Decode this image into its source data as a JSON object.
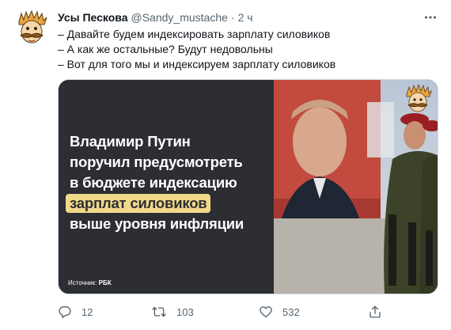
{
  "tweet": {
    "display_name": "Усы Пескова",
    "handle": "@Sandy_mustache",
    "separator": "·",
    "time": "2 ч",
    "lines": [
      "– Давайте будем индексировать зарплату силовиков",
      "– А как же остальные? Будут недовольны",
      "– Вот для того мы и индексируем зарплату силовиков"
    ]
  },
  "media": {
    "headline_lines": [
      "Владимир Путин",
      "поручил предусмотреть",
      "в бюджете индексацию"
    ],
    "highlight": "зарплат силовиков",
    "headline_last": "выше уровня инфляции",
    "source_label": "Источник:",
    "source_name": "РБК"
  },
  "actions": {
    "reply_count": "12",
    "retweet_count": "103",
    "like_count": "532"
  },
  "icons": {
    "more": "more-dots-icon",
    "reply": "reply-icon",
    "retweet": "retweet-icon",
    "like": "heart-icon",
    "share": "share-icon"
  },
  "colors": {
    "text_primary": "#0f1419",
    "text_secondary": "#536471",
    "media_background": "#2c2e33",
    "highlight": "#f2d98a"
  }
}
